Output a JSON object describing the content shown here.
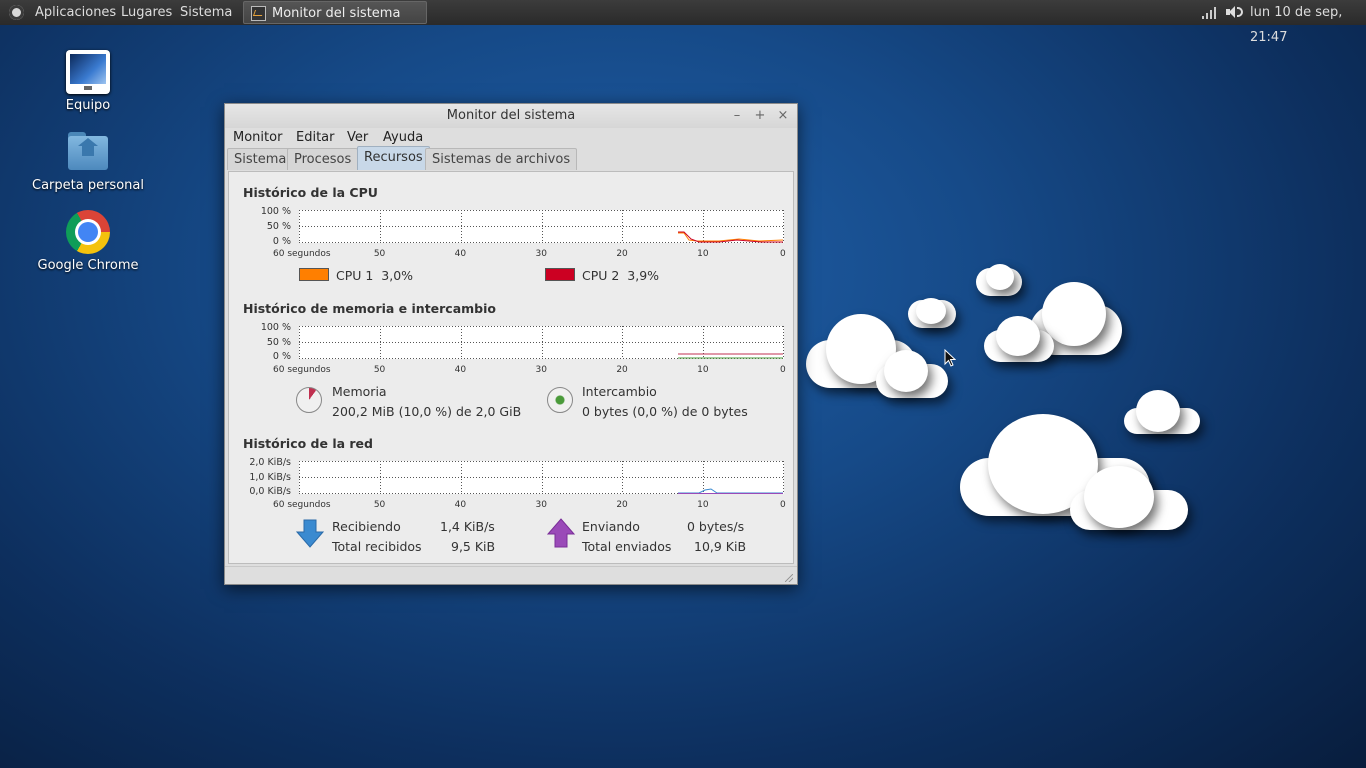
{
  "panel": {
    "menus": [
      "Aplicaciones",
      "Lugares",
      "Sistema"
    ],
    "task_title": "Monitor del sistema",
    "clock": "lun 10 de sep, 21:47"
  },
  "desktop": {
    "icons": [
      {
        "label": "Equipo",
        "icon": "computer-icon"
      },
      {
        "label": "Carpeta personal",
        "icon": "home-folder-icon"
      },
      {
        "label": "Google Chrome",
        "icon": "chrome-icon"
      }
    ]
  },
  "window": {
    "title": "Monitor del sistema",
    "menu": [
      "Monitor",
      "Editar",
      "Ver",
      "Ayuda"
    ],
    "tabs": [
      "Sistema",
      "Procesos",
      "Recursos",
      "Sistemas de archivos"
    ],
    "active_tab": "Recursos",
    "x_ticks": [
      "60 segundos",
      "50",
      "40",
      "30",
      "20",
      "10",
      "0"
    ],
    "cpu": {
      "title": "Histórico de la CPU",
      "y_ticks": [
        "100 %",
        "50 %",
        "0 %"
      ],
      "series": [
        {
          "name": "CPU 1",
          "value": "3,0%",
          "color": "#ff7f00"
        },
        {
          "name": "CPU 2",
          "value": "3,9%",
          "color": "#cc0022"
        }
      ]
    },
    "memory": {
      "title": "Histórico de memoria e intercambio",
      "y_ticks": [
        "100 %",
        "50 %",
        "0 %"
      ],
      "mem_label": "Memoria",
      "mem_value": "200,2 MiB (10,0 %) de 2,0 GiB",
      "mem_fraction": 0.1,
      "mem_color": "#c03050",
      "swap_label": "Intercambio",
      "swap_value": "0 bytes (0,0 %) de 0 bytes",
      "swap_color": "#4a9a3a"
    },
    "network": {
      "title": "Histórico de la red",
      "y_ticks": [
        "2,0 KiB/s",
        "1,0 KiB/s",
        "0,0 KiB/s"
      ],
      "recv_label": "Recibiendo",
      "recv_rate": "1,4 KiB/s",
      "recv_total_label": "Total recibidos",
      "recv_total": "9,5 KiB",
      "send_label": "Enviando",
      "send_rate": "0 bytes/s",
      "send_total_label": "Total enviados",
      "send_total": "10,9 KiB",
      "recv_color": "#3a8ad0",
      "send_color": "#9a4ab8"
    }
  }
}
